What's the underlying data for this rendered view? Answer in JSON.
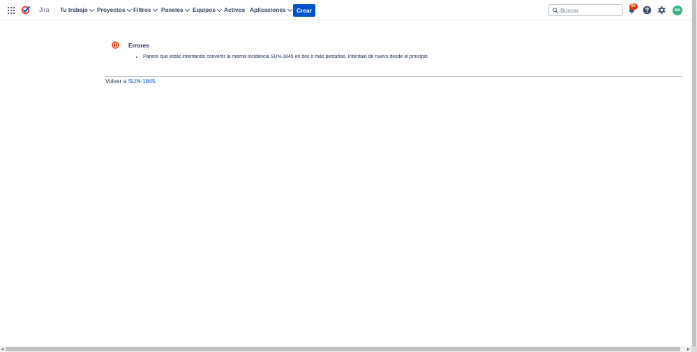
{
  "header": {
    "product_name": "Jira",
    "nav": [
      {
        "label": "Tu trabajo",
        "dropdown": true
      },
      {
        "label": "Proyectos",
        "dropdown": true
      },
      {
        "label": "Filtros",
        "dropdown": true
      },
      {
        "label": "Paneles",
        "dropdown": true
      },
      {
        "label": "Equipos",
        "dropdown": true
      },
      {
        "label": "Activos",
        "dropdown": false
      },
      {
        "label": "Aplicaciones",
        "dropdown": true
      }
    ],
    "create_label": "Crear",
    "search": {
      "placeholder": "Buscar",
      "value": ""
    },
    "notifications_badge": "9+",
    "avatar_initials": "MA",
    "icons": {
      "app_switcher": "app-grid-icon",
      "logo": "jira-logo-icon",
      "search": "search-icon",
      "notifications": "bell-icon",
      "help": "help-icon",
      "settings": "gear-icon"
    }
  },
  "main": {
    "error_title": "Errores",
    "errors": [
      "Parece que estás intentando convertir la misma incidencia SUN-1845 en dos o más pestañas. Inténtalo de nuevo desde el principio."
    ],
    "back_prefix": "Volver a",
    "back_link": "SUN-1845",
    "icons": {
      "error": "error-icon"
    }
  },
  "colors": {
    "brand": "#0052cc",
    "error": "#de350b",
    "avatar": "#36b37e"
  }
}
